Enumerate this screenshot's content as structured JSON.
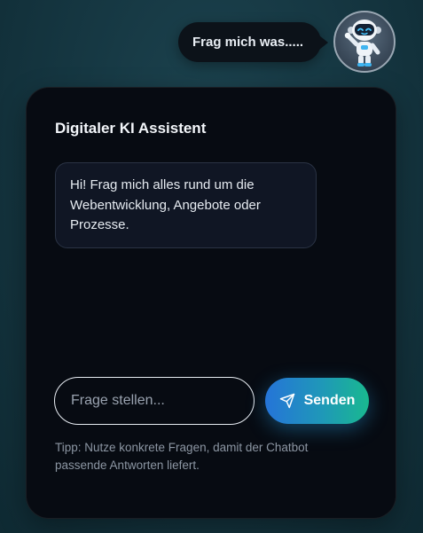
{
  "launcher": {
    "bubble_text": "Frag mich was.....",
    "avatar_icon": "robot-icon"
  },
  "chat": {
    "title": "Digitaler KI Assistent",
    "messages": [
      {
        "sender": "bot",
        "text": "Hi! Frag mich alles rund um die Webentwicklung, Angebote oder Prozesse."
      }
    ],
    "input": {
      "value": "",
      "placeholder": "Frage stellen..."
    },
    "send_button": {
      "label": "Senden",
      "icon": "send-icon"
    },
    "tip": "Tipp: Nutze konkrete Fragen, damit der Chatbot passende Antworten liefert."
  },
  "colors": {
    "background": "#163843",
    "panel": "#070b12",
    "message_bg": "#101624",
    "accent_start": "#2574d8",
    "accent_end": "#19b98f"
  }
}
